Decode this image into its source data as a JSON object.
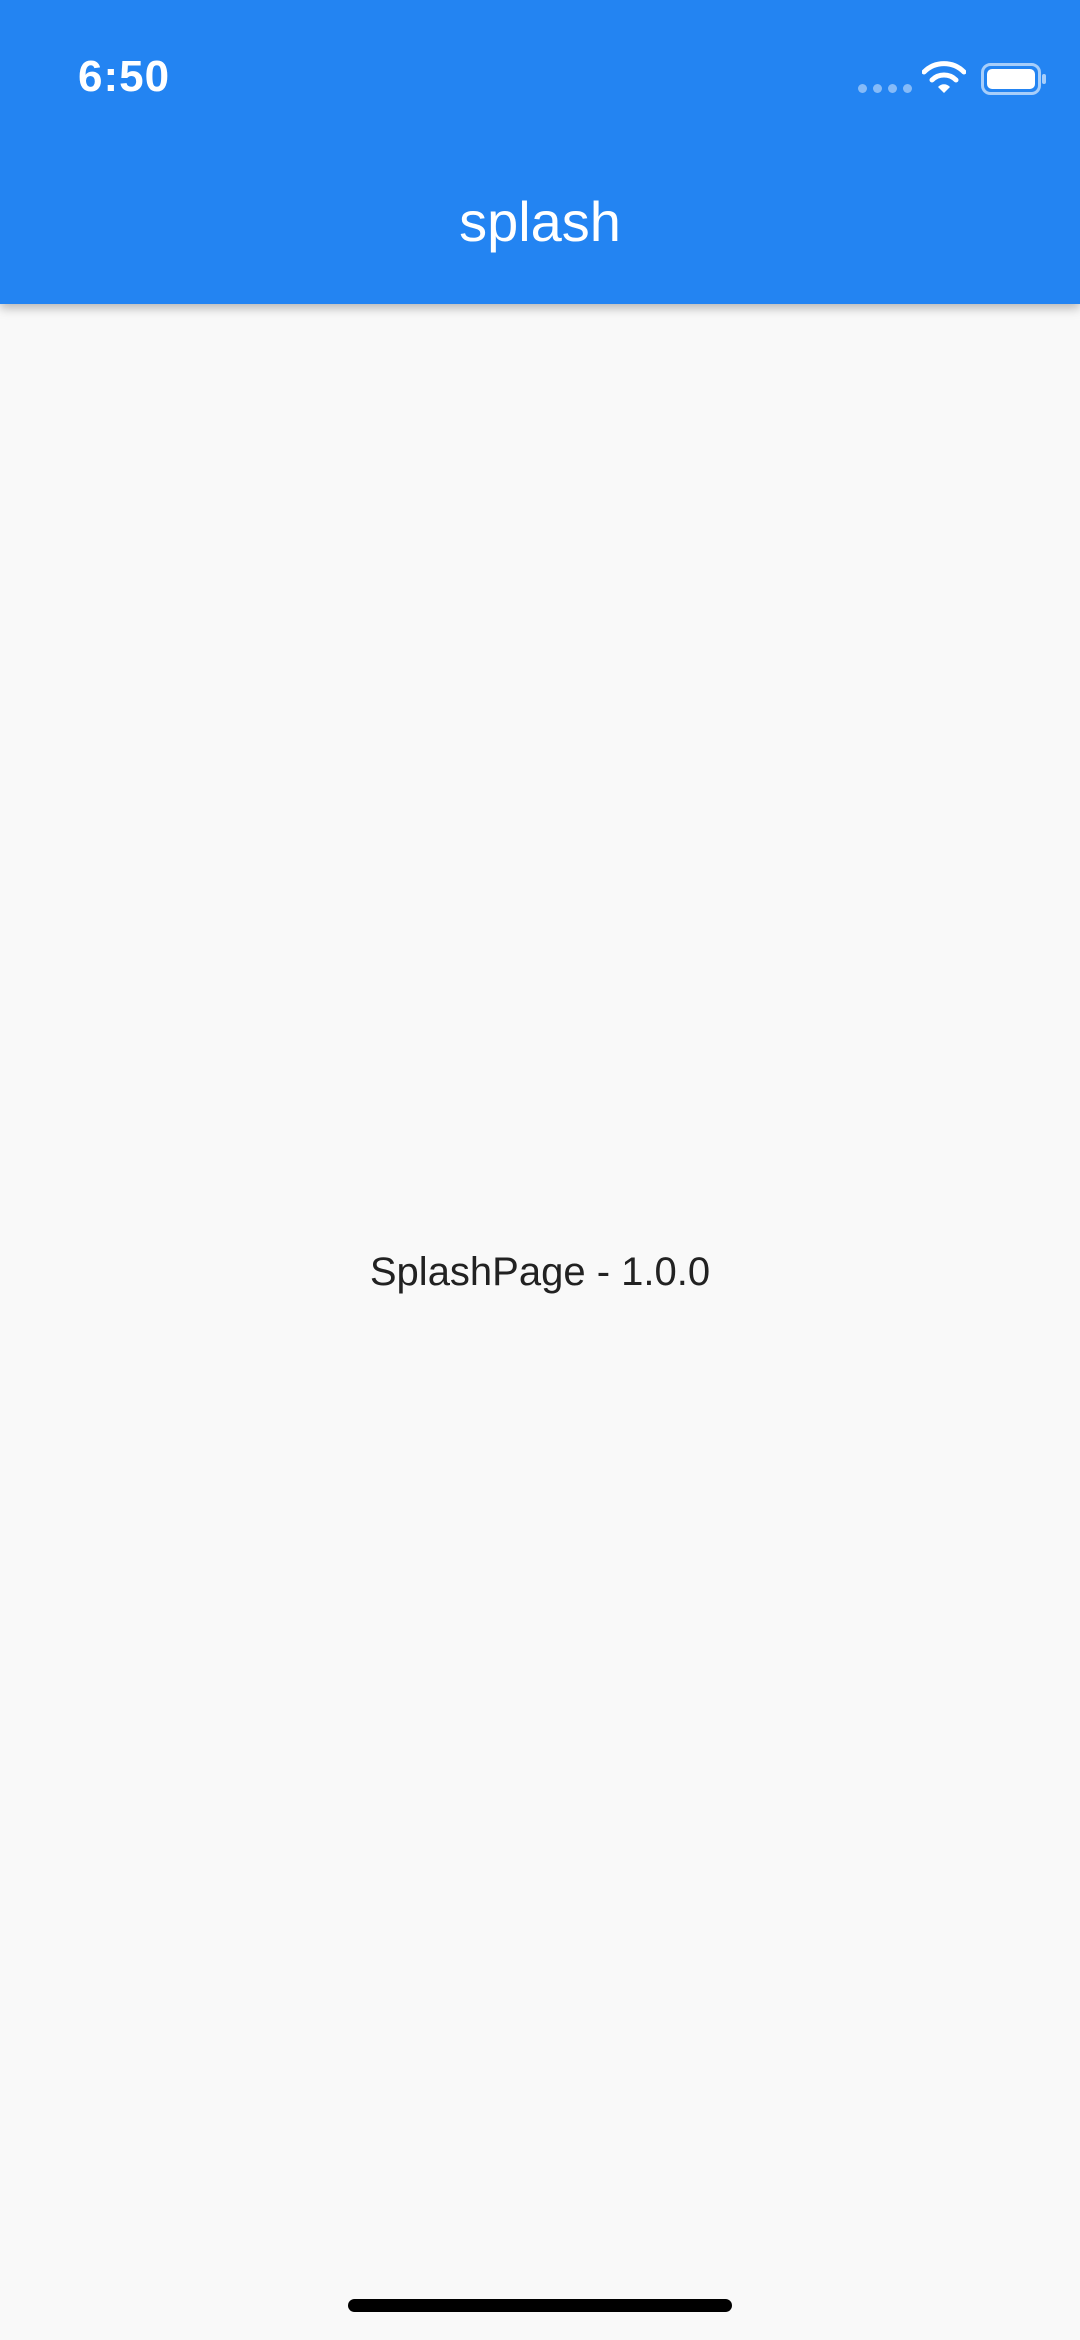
{
  "status_bar": {
    "time": "6:50",
    "icons": [
      "signal-dots-icon",
      "wifi-icon",
      "battery-icon"
    ]
  },
  "app_bar": {
    "title": "splash",
    "color": "#2384f2"
  },
  "content": {
    "label": "SplashPage - 1.0.0",
    "background": "#f9f9f9"
  }
}
